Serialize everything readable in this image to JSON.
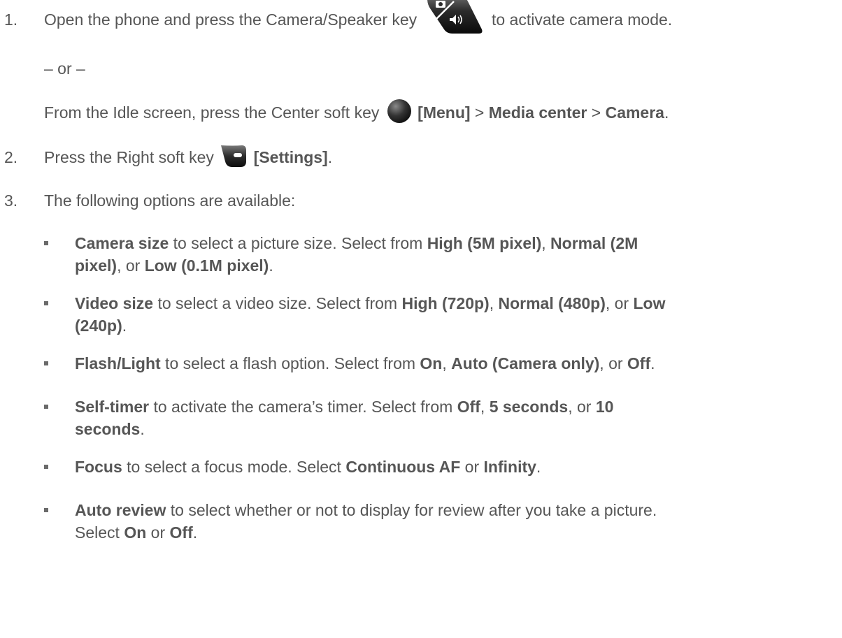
{
  "step1": {
    "number": "1.",
    "pre": "Open the phone and press the Camera/Speaker key",
    "post": "to activate camera mode.",
    "icon": "camera-speaker-key-icon"
  },
  "or_text": "– or –",
  "alt": {
    "pre": "From the Idle screen, press the Center soft key",
    "icon": "center-soft-key-icon",
    "menu": "[Menu]",
    "sep1": " > ",
    "media": "Media center",
    "sep2": " > ",
    "camera": "Camera",
    "end": "."
  },
  "step2": {
    "number": "2.",
    "pre": "Press the Right soft key",
    "icon": "right-soft-key-icon",
    "settings": "[Settings]",
    "end": "."
  },
  "step3": {
    "number": "3.",
    "text": "The following options are available:"
  },
  "options": [
    {
      "name": "Camera size",
      "t1": " to select a picture size. Select from ",
      "b1": "High (5M pixel)",
      "t2": ", ",
      "b2": "Normal (2M",
      "b2b": "pixel)",
      "t3": ", or ",
      "b3": "Low (0.1M pixel)",
      "t4": "."
    },
    {
      "name": "Video size",
      "t1": " to select a video size. Select from ",
      "b1": "High (720p)",
      "t2": ", ",
      "b2": "Normal (480p)",
      "t3": ", or ",
      "b3": "Low",
      "b3b": "(240p)",
      "t4": "."
    },
    {
      "name": "Flash/Light",
      "t1": " to select a flash option. Select from ",
      "b1": "On",
      "t2": ", ",
      "b2": "Auto (Camera only)",
      "t3": ", or ",
      "b3": "Off",
      "t4": "."
    },
    {
      "name": "Self-timer",
      "t1": " to activate the camera’s timer. Select from ",
      "b1": "Off",
      "t2": ", ",
      "b2": "5 seconds",
      "t3": ", or ",
      "b3": "10",
      "b3b": "seconds",
      "t4": "."
    },
    {
      "name": "Focus",
      "t1": " to select a focus mode. Select ",
      "b1": "Continuous AF",
      "t2": " or ",
      "b2": "Infinity",
      "t3": "."
    },
    {
      "name": "Auto review",
      "t1": " to select whether or not to display for review after you take a picture.",
      "t2": "Select ",
      "b1": "On",
      "t3": " or ",
      "b2": "Off",
      "t4": "."
    }
  ]
}
